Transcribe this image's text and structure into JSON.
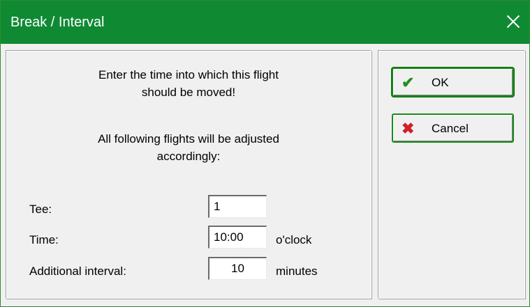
{
  "window": {
    "title": "Break / Interval"
  },
  "message": {
    "line1": "Enter the time into which this flight",
    "line2": "should be moved!",
    "line3": "All following flights will be adjusted",
    "line4": "accordingly:"
  },
  "fields": {
    "tee": {
      "label": "Tee:",
      "value": "1"
    },
    "time": {
      "label": "Time:",
      "value": "10:00",
      "unit": "o'clock"
    },
    "interval": {
      "label": "Additional interval:",
      "value": "10",
      "unit": "minutes"
    }
  },
  "buttons": {
    "ok": {
      "label": "OK",
      "icon": "check-icon"
    },
    "cancel": {
      "label": "Cancel",
      "icon": "cross-icon"
    }
  },
  "colors": {
    "titlebar": "#0f8a33",
    "ok_icon": "#1f8f1f",
    "cancel_icon": "#d0202a"
  }
}
